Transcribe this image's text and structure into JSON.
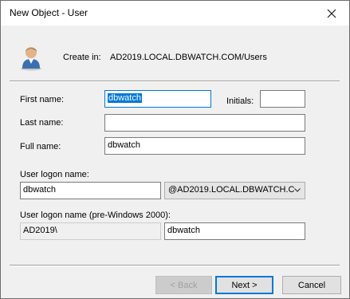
{
  "window": {
    "title": "New Object - User"
  },
  "header": {
    "create_in_label": "Create in:",
    "create_in_value": "AD2019.LOCAL.DBWATCH.COM/Users"
  },
  "form": {
    "first_name_label": "First name:",
    "first_name_value": "dbwatch",
    "initials_label": "Initials:",
    "initials_value": "",
    "last_name_label": "Last name:",
    "last_name_value": "",
    "full_name_label": "Full name:",
    "full_name_value": "dbwatch",
    "logon_label": "User logon name:",
    "logon_value": "dbwatch",
    "domain_selected": "@AD2019.LOCAL.DBWATCH.C",
    "pre2000_label": "User logon name (pre-Windows 2000):",
    "pre2000_domain": "AD2019\\",
    "pre2000_value": "dbwatch"
  },
  "buttons": {
    "back": "< Back",
    "next": "Next >",
    "cancel": "Cancel"
  },
  "colors": {
    "accent": "#0078d7",
    "dialog_bg": "#f0f0f0"
  },
  "icons": {
    "close": "close-icon",
    "user": "user-icon",
    "dropdown": "chevron-down-icon"
  }
}
